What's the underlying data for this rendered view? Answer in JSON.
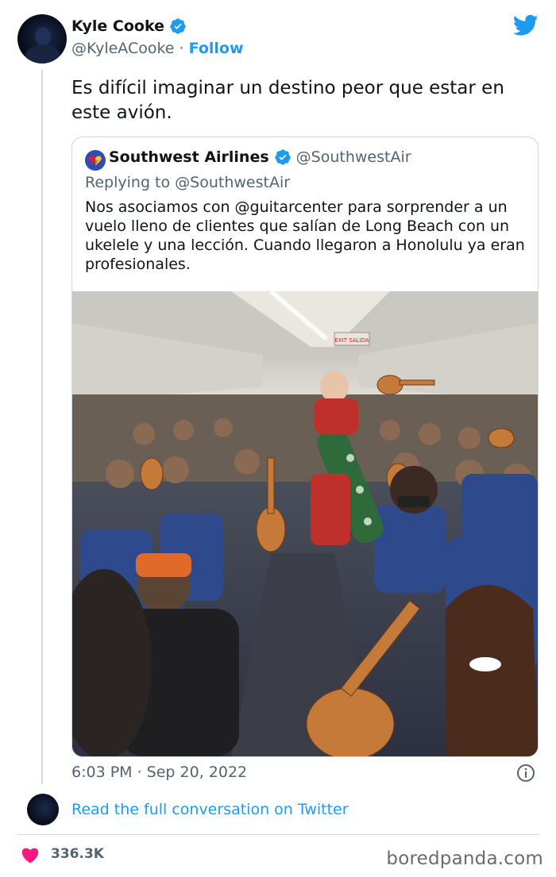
{
  "author": {
    "display_name": "Kyle Cooke",
    "handle": "@KyleACooke",
    "separator": "·",
    "follow_label": "Follow"
  },
  "tweet": {
    "text": "Es difícil imaginar un destino peor que estar en este avión.",
    "timestamp": "6:03 PM · Sep 20, 2022"
  },
  "quoted_tweet": {
    "display_name": "Southwest Airlines",
    "handle": "@SouthwestAir",
    "replying_to": "Replying to @SouthwestAir",
    "text": "Nos asociamos con @guitarcenter para sorprender a un vuelo lleno de clientes que salían de Long Beach con un ukelele y una lección. Cuando llegaron a Honolulu ya eran profesionales.",
    "photo_sign": "EXIT SALIDA"
  },
  "footer": {
    "read_link": "Read the full conversation on Twitter",
    "like_count": "336.3K",
    "watermark": "boredpanda.com"
  },
  "colors": {
    "twitter_blue": "#1d9bf0",
    "text_primary": "#0f1419",
    "text_secondary": "#536471",
    "like_pink": "#f91880",
    "border": "#cfd9de",
    "southwest_blue": "#304cb2"
  },
  "icons": [
    "verified-badge-icon",
    "twitter-bird-icon",
    "southwest-heart-logo",
    "info-icon",
    "heart-icon"
  ]
}
